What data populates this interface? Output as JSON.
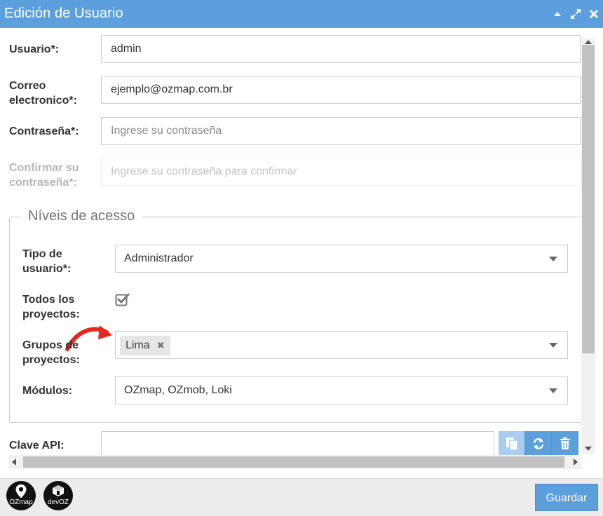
{
  "window": {
    "title": "Edición de Usuario",
    "icons": [
      "collapse-icon",
      "maximize-icon",
      "close-icon"
    ]
  },
  "form": {
    "user": {
      "label": "Usuario*:",
      "value": "admin"
    },
    "email": {
      "label_line1": "Correo",
      "label_line2": "electronico*:",
      "value": "ejemplo@ozmap.com.br"
    },
    "password": {
      "label": "Contraseña*:",
      "placeholder": "Ingrese su contraseña"
    },
    "confirm": {
      "label_line1": "Confirmar su",
      "label_line2": "contraseña*:",
      "placeholder": "Ingrese su contraseña para confirmar"
    }
  },
  "access": {
    "legend": "Níveis de acesso",
    "user_type": {
      "label_line1": "Tipo de",
      "label_line2": "usuario*:",
      "value": "Administrador"
    },
    "all_projects": {
      "label_line1": "Todos los",
      "label_line2": "proyectos:",
      "checked": true
    },
    "project_groups": {
      "label_line1": "Grupos de",
      "label_line2": "proyectos:",
      "tags": [
        "Lima"
      ]
    },
    "modules": {
      "label": "Módulos:",
      "value": "OZmap, OZmob, Loki"
    }
  },
  "api_key": {
    "label": "Clave API:",
    "value": "",
    "buttons": [
      "copy-icon",
      "refresh-icon",
      "trash-icon"
    ]
  },
  "footer": {
    "logos": [
      {
        "name": "ozmap-logo",
        "label": "OZmap"
      },
      {
        "name": "devoz-logo",
        "label": "devOZ"
      }
    ],
    "save_label": "Guardar"
  },
  "colors": {
    "accent": "#5b9fdc",
    "annotation_arrow": "#e8261c"
  }
}
